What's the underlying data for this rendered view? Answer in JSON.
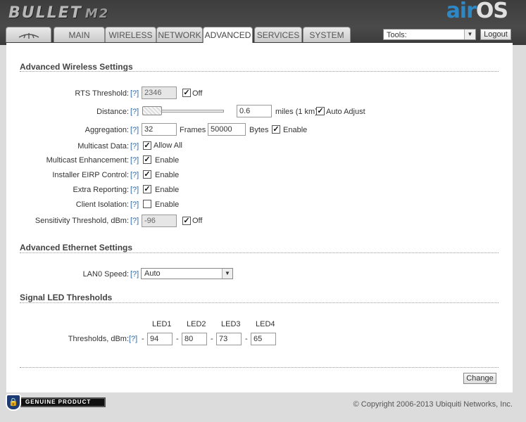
{
  "header": {
    "brand": "BULLET",
    "model": "M2",
    "logo_air": "air",
    "logo_os": "OS",
    "tabs": [
      {
        "label": "ubnt-logo-tab",
        "icon": "ubiquiti-logo"
      },
      {
        "label": "MAIN"
      },
      {
        "label": "WIRELESS"
      },
      {
        "label": "NETWORK"
      },
      {
        "label": "ADVANCED",
        "active": true
      },
      {
        "label": "SERVICES"
      },
      {
        "label": "SYSTEM"
      }
    ],
    "tools_value": "Tools:",
    "logout_label": "Logout"
  },
  "wireless": {
    "title": "Advanced Wireless Settings",
    "help": "[?]",
    "rts_label": "RTS Threshold:",
    "rts_value": "2346",
    "rts_off_label": "Off",
    "distance_label": "Distance:",
    "distance_value": "0.6",
    "distance_unit": "miles (1 km)",
    "auto_adjust_label": "Auto Adjust",
    "aggregation_label": "Aggregation:",
    "aggregation_frames": "32",
    "frames_label": "Frames",
    "aggregation_bytes": "50000",
    "bytes_label": "Bytes",
    "aggregation_enable_label": "Enable",
    "multicast_label": "Multicast Data:",
    "multicast_allow_label": "Allow All",
    "mc_enh_label": "Multicast Enhancement:",
    "eirp_label": "Installer EIRP Control:",
    "extra_label": "Extra Reporting:",
    "isolation_label": "Client Isolation:",
    "enable_label": "Enable",
    "sens_label": "Sensitivity Threshold, dBm:",
    "sens_value": "-96",
    "sens_off_label": "Off"
  },
  "ethernet": {
    "title": "Advanced Ethernet Settings",
    "lan_label": "LAN0 Speed:",
    "lan_value": "Auto"
  },
  "led": {
    "title": "Signal LED Thresholds",
    "headers": [
      "LED1",
      "LED2",
      "LED3",
      "LED4"
    ],
    "label": "Thresholds, dBm:",
    "dash": "-",
    "values": [
      "94",
      "80",
      "73",
      "65"
    ]
  },
  "footer": {
    "change_label": "Change",
    "genuine_text": "GENUINE PRODUCT",
    "copyright": "© Copyright 2006-2013 Ubiquiti Networks, Inc."
  }
}
